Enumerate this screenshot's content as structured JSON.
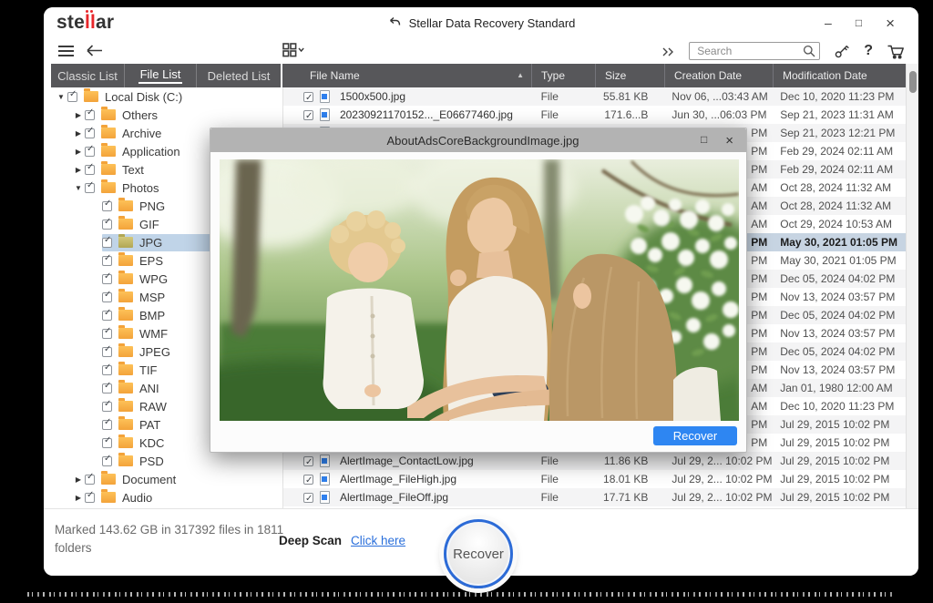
{
  "window": {
    "app_title": "Stellar Data Recovery Standard",
    "minimize": "–",
    "maximize": "□",
    "close": "×"
  },
  "logo": {
    "part1": "ste",
    "part2": "ll",
    "part3": "ar"
  },
  "toolbar": {
    "search_placeholder": "Search"
  },
  "tabs": [
    {
      "label": "Classic List",
      "active": false
    },
    {
      "label": "File List",
      "active": true
    },
    {
      "label": "Deleted List",
      "active": false
    }
  ],
  "tree": {
    "items": [
      {
        "label": "Local Disk (C:)",
        "level": 0,
        "expanded": "open",
        "checked": true,
        "selected": false
      },
      {
        "label": "Others",
        "level": 1,
        "expanded": "closed",
        "checked": true,
        "selected": false
      },
      {
        "label": "Archive",
        "level": 1,
        "expanded": "closed",
        "checked": true,
        "selected": false
      },
      {
        "label": "Application",
        "level": 1,
        "expanded": "closed",
        "checked": true,
        "selected": false
      },
      {
        "label": "Text",
        "level": 1,
        "expanded": "closed",
        "checked": true,
        "selected": false
      },
      {
        "label": "Photos",
        "level": 1,
        "expanded": "open",
        "checked": true,
        "selected": false
      },
      {
        "label": "PNG",
        "level": 2,
        "expanded": "none",
        "checked": true,
        "selected": false
      },
      {
        "label": "GIF",
        "level": 2,
        "expanded": "none",
        "checked": true,
        "selected": false
      },
      {
        "label": "JPG",
        "level": 2,
        "expanded": "none",
        "checked": true,
        "selected": true
      },
      {
        "label": "EPS",
        "level": 2,
        "expanded": "none",
        "checked": true,
        "selected": false
      },
      {
        "label": "WPG",
        "level": 2,
        "expanded": "none",
        "checked": true,
        "selected": false
      },
      {
        "label": "MSP",
        "level": 2,
        "expanded": "none",
        "checked": true,
        "selected": false
      },
      {
        "label": "BMP",
        "level": 2,
        "expanded": "none",
        "checked": true,
        "selected": false
      },
      {
        "label": "WMF",
        "level": 2,
        "expanded": "none",
        "checked": true,
        "selected": false
      },
      {
        "label": "JPEG",
        "level": 2,
        "expanded": "none",
        "checked": true,
        "selected": false
      },
      {
        "label": "TIF",
        "level": 2,
        "expanded": "none",
        "checked": true,
        "selected": false
      },
      {
        "label": "ANI",
        "level": 2,
        "expanded": "none",
        "checked": true,
        "selected": false
      },
      {
        "label": "RAW",
        "level": 2,
        "expanded": "none",
        "checked": true,
        "selected": false
      },
      {
        "label": "PAT",
        "level": 2,
        "expanded": "none",
        "checked": true,
        "selected": false
      },
      {
        "label": "KDC",
        "level": 2,
        "expanded": "none",
        "checked": true,
        "selected": false
      },
      {
        "label": "PSD",
        "level": 2,
        "expanded": "none",
        "checked": true,
        "selected": false
      },
      {
        "label": "Document",
        "level": 1,
        "expanded": "closed",
        "checked": true,
        "selected": false
      },
      {
        "label": "Audio",
        "level": 1,
        "expanded": "closed",
        "checked": true,
        "selected": false
      }
    ]
  },
  "table": {
    "columns": [
      "File Name",
      "Type",
      "Size",
      "Creation Date",
      "Modification Date"
    ],
    "sort": {
      "column": "File Name",
      "direction": "asc"
    },
    "rows": [
      {
        "name": "1500x500.jpg",
        "type": "File",
        "size": "55.81 KB",
        "created": "Nov 06, ...03:43 AM",
        "modified": "Dec 10, 2020 11:23 PM",
        "covered": false,
        "selected": false
      },
      {
        "name": "20230921170152..._E06677460.jpg",
        "type": "File",
        "size": "171.6...B",
        "created": "Jun 30, ...06:03 PM",
        "modified": "Sep 21, 2023 11:31 AM",
        "covered": false,
        "selected": false
      },
      {
        "name": "",
        "type": "",
        "size": "",
        "created": "PM",
        "modified": "Sep 21, 2023 12:21 PM",
        "covered": true,
        "selected": false
      },
      {
        "name": "",
        "type": "",
        "size": "",
        "created": "PM",
        "modified": "Feb 29, 2024 02:11 AM",
        "covered": true,
        "selected": false
      },
      {
        "name": "",
        "type": "",
        "size": "",
        "created": "PM",
        "modified": "Feb 29, 2024 02:11 AM",
        "covered": true,
        "selected": false
      },
      {
        "name": "",
        "type": "",
        "size": "",
        "created": "AM",
        "modified": "Oct 28, 2024 11:32 AM",
        "covered": true,
        "selected": false
      },
      {
        "name": "",
        "type": "",
        "size": "",
        "created": "AM",
        "modified": "Oct 28, 2024 11:32 AM",
        "covered": true,
        "selected": false
      },
      {
        "name": "",
        "type": "",
        "size": "",
        "created": "AM",
        "modified": "Oct 29, 2024 10:53 AM",
        "covered": true,
        "selected": false
      },
      {
        "name": "",
        "type": "",
        "size": "",
        "created": "PM",
        "modified": "May 30, 2021 01:05 PM",
        "covered": true,
        "selected": true
      },
      {
        "name": "",
        "type": "",
        "size": "",
        "created": "PM",
        "modified": "May 30, 2021 01:05 PM",
        "covered": true,
        "selected": false
      },
      {
        "name": "",
        "type": "",
        "size": "",
        "created": "PM",
        "modified": "Dec 05, 2024 04:02 PM",
        "covered": true,
        "selected": false
      },
      {
        "name": "",
        "type": "",
        "size": "",
        "created": "PM",
        "modified": "Nov 13, 2024 03:57 PM",
        "covered": true,
        "selected": false
      },
      {
        "name": "",
        "type": "",
        "size": "",
        "created": "PM",
        "modified": "Dec 05, 2024 04:02 PM",
        "covered": true,
        "selected": false
      },
      {
        "name": "",
        "type": "",
        "size": "",
        "created": "PM",
        "modified": "Nov 13, 2024 03:57 PM",
        "covered": true,
        "selected": false
      },
      {
        "name": "",
        "type": "",
        "size": "",
        "created": "PM",
        "modified": "Dec 05, 2024 04:02 PM",
        "covered": true,
        "selected": false
      },
      {
        "name": "",
        "type": "",
        "size": "",
        "created": "PM",
        "modified": "Nov 13, 2024 03:57 PM",
        "covered": true,
        "selected": false
      },
      {
        "name": "",
        "type": "",
        "size": "",
        "created": "AM",
        "modified": "Jan 01, 1980 12:00 AM",
        "covered": true,
        "selected": false
      },
      {
        "name": "",
        "type": "",
        "size": "",
        "created": "AM",
        "modified": "Dec 10, 2020 11:23 PM",
        "covered": true,
        "selected": false
      },
      {
        "name": "",
        "type": "",
        "size": "",
        "created": "PM",
        "modified": "Jul 29, 2015 10:02 PM",
        "covered": true,
        "selected": false
      },
      {
        "name": "",
        "type": "",
        "size": "",
        "created": "PM",
        "modified": "Jul 29, 2015 10:02 PM",
        "covered": true,
        "selected": false
      },
      {
        "name": "AlertImage_ContactLow.jpg",
        "type": "File",
        "size": "11.86 KB",
        "created": "Jul 29, 2... 10:02 PM",
        "modified": "Jul 29, 2015 10:02 PM",
        "covered": false,
        "selected": false
      },
      {
        "name": "AlertImage_FileHigh.jpg",
        "type": "File",
        "size": "18.01 KB",
        "created": "Jul 29, 2... 10:02 PM",
        "modified": "Jul 29, 2015 10:02 PM",
        "covered": false,
        "selected": false
      },
      {
        "name": "AlertImage_FileOff.jpg",
        "type": "File",
        "size": "17.71 KB",
        "created": "Jul 29, 2... 10:02 PM",
        "modified": "Jul 29, 2015 10:02 PM",
        "covered": false,
        "selected": false
      }
    ]
  },
  "preview_window": {
    "title": "AboutAdsCoreBackgroundImage.jpg",
    "maximize": "□",
    "close": "×",
    "recover_button": "Recover",
    "image_description": "Mother holding a blonde toddler beside a young girl in a blossoming spring garden"
  },
  "footer": {
    "marked_text": "Marked 143.62 GB in 317392 files in 1811 folders",
    "deep_scan_label": "Deep Scan",
    "deep_scan_link": "Click here",
    "recover_button": "Recover"
  },
  "colors": {
    "header_bg": "#57575a",
    "accent_blue": "#2e86f2",
    "selected_row_bg": "#c7d4e2",
    "tree_selected_bg": "#c0d4e8",
    "link_blue": "#2a6fdb",
    "logo_red": "#e8262a"
  }
}
